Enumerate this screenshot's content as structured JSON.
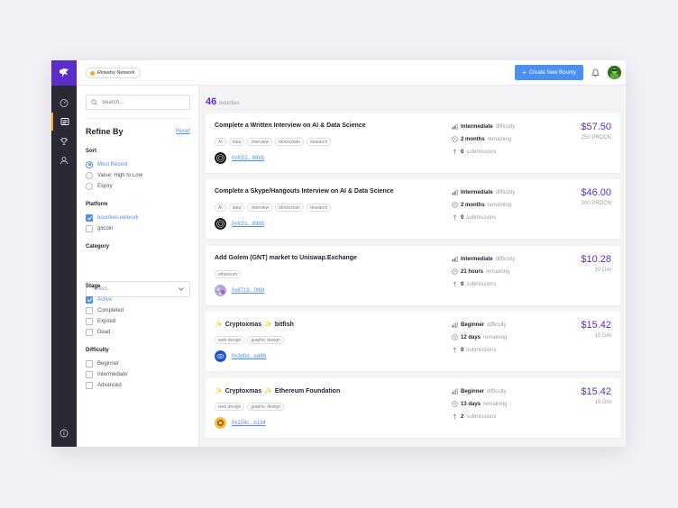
{
  "topbar": {
    "network": "Rinkeby Network",
    "create_label": "Create New Bounty"
  },
  "filters": {
    "search_placeholder": "Search...",
    "title": "Refine By",
    "reset": "Reset",
    "sort": {
      "label": "Sort",
      "options": [
        "Most Recent",
        "Value: High to Low",
        "Expiry"
      ],
      "selected": "Most Recent"
    },
    "platform": {
      "label": "Platform",
      "options": [
        "bounties-network",
        "gitcoin"
      ],
      "checked": [
        "bounties-network"
      ]
    },
    "category": {
      "label": "Category",
      "placeholder": "Select..."
    },
    "stage": {
      "label": "Stage",
      "options": [
        "Active",
        "Completed",
        "Expired",
        "Dead"
      ],
      "checked": [
        "Active"
      ]
    },
    "difficulty": {
      "label": "Difficulty",
      "options": [
        "Beginner",
        "Intermediate",
        "Advanced"
      ]
    }
  },
  "results": {
    "count": "46",
    "count_label": "bounties"
  },
  "labels": {
    "difficulty": "difficulty",
    "remaining": "remaining",
    "submissions": "submissions"
  },
  "bounties": [
    {
      "title": "Complete a Written Interview on AI & Data Science",
      "tags": [
        "AI",
        "data",
        "interview",
        "blockchain",
        "research"
      ],
      "address": "0xfc51...89b5",
      "difficulty": "Intermediate",
      "time": "2 months",
      "submissions": "0",
      "price": "$57.50",
      "token": "250 PROCN"
    },
    {
      "title": "Complete a Skype/Hangouts Interview on AI & Data Science",
      "tags": [
        "AI",
        "data",
        "interview",
        "blockchain",
        "research"
      ],
      "address": "0xfc51...89b5",
      "difficulty": "Intermediate",
      "time": "2 months",
      "submissions": "0",
      "price": "$46.00",
      "token": "200 PROCN"
    },
    {
      "title": "Add Golem (GNT) market to Uniswap.Exchange",
      "tags": [
        "ethereum"
      ],
      "address": "0x8719...0f69",
      "difficulty": "Intermediate",
      "time": "21 hours",
      "submissions": "0",
      "price": "$10.28",
      "token": "10 DAI"
    },
    {
      "title_a": "Cryptoxmas",
      "title_b": "bitfish",
      "tags": [
        "web design",
        "graphic design"
      ],
      "address": "0x3d0d...ed86",
      "difficulty": "Beginner",
      "time": "12 days",
      "submissions": "0",
      "price": "$15.42",
      "token": "15 DAI"
    },
    {
      "title_a": "Cryptoxmas",
      "title_b": "Ethereum Foundation",
      "tags": [
        "web design",
        "graphic design"
      ],
      "address": "0x224c...b134",
      "difficulty": "Beginner",
      "time": "13 days",
      "submissions": "2",
      "price": "$15.42",
      "token": "15 DAI"
    }
  ],
  "colors": {
    "brand": "#5b2dc9",
    "accent": "#4a90f0",
    "network_dot": "#f6a623",
    "rail": "#2a2a37"
  },
  "icons": {
    "rail": [
      "dashboard-icon",
      "explorer-icon",
      "leaderboard-trophy-icon",
      "profile-icon",
      "info-icon"
    ]
  }
}
